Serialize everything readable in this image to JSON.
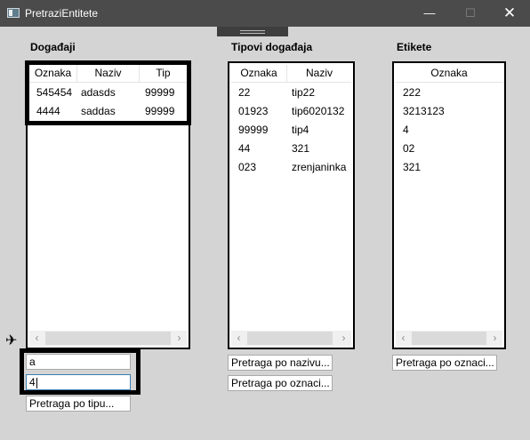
{
  "window": {
    "title": "PretraziEntitete",
    "min_icon": "—",
    "max_icon": "☐",
    "close_icon": "✕"
  },
  "events": {
    "label": "Događaji",
    "columns": [
      "Oznaka",
      "Naziv",
      "Tip"
    ],
    "rows": [
      {
        "oznaka": "545454",
        "naziv": "adasds",
        "tip": "99999"
      },
      {
        "oznaka": "4444",
        "naziv": "saddas",
        "tip": "99999"
      }
    ]
  },
  "event_types": {
    "label": "Tipovi događaja",
    "columns": [
      "Oznaka",
      "Naziv"
    ],
    "rows": [
      {
        "oznaka": "22",
        "naziv": "tip22"
      },
      {
        "oznaka": "01923",
        "naziv": "tip6020132"
      },
      {
        "oznaka": "99999",
        "naziv": "tip4"
      },
      {
        "oznaka": "44",
        "naziv": "321"
      },
      {
        "oznaka": "023",
        "naziv": "zrenjaninka"
      }
    ]
  },
  "tags": {
    "label": "Etikete",
    "columns": [
      "Oznaka"
    ],
    "rows": [
      "222",
      "3213123",
      "4",
      "02",
      "321"
    ]
  },
  "search_events": {
    "field1_value": "a",
    "field2_value": "4",
    "field3_placeholder": "Pretraga po tipu..."
  },
  "search_types": {
    "by_name_placeholder": "Pretraga po nazivu...",
    "by_label_placeholder": "Pretraga po oznaci..."
  },
  "search_tags": {
    "by_label_placeholder": "Pretraga po oznaci..."
  },
  "scroll": {
    "left_arrow": "‹",
    "right_arrow": "›"
  },
  "cursor_icon": "✈"
}
